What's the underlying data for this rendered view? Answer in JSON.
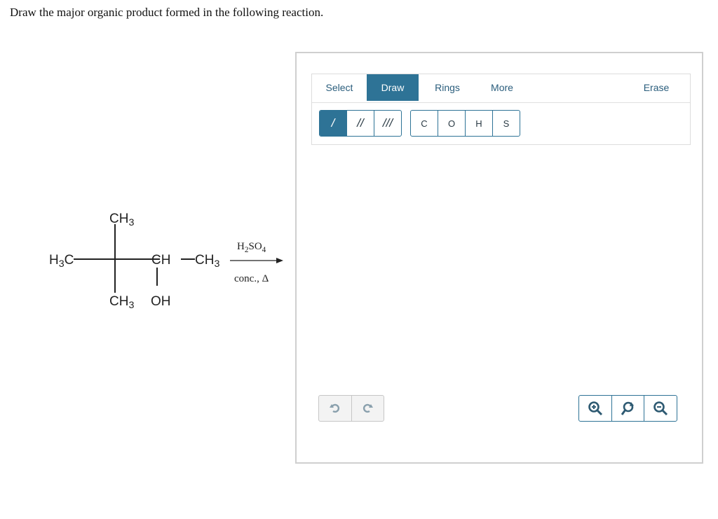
{
  "question": {
    "text": "Draw the major organic product formed in the following reaction."
  },
  "reaction": {
    "top_group": "CH3",
    "left_group": "H3C",
    "center_chain": "CH",
    "right_group": "CH3",
    "bottom_left": "CH3",
    "bottom_right": "OH",
    "reagent": "H2SO4",
    "conditions": "conc., Δ"
  },
  "editor": {
    "tabs": [
      {
        "label": "Select",
        "active": false
      },
      {
        "label": "Draw",
        "active": true
      },
      {
        "label": "Rings",
        "active": false
      },
      {
        "label": "More",
        "active": false
      },
      {
        "label": "Erase",
        "active": false
      }
    ],
    "bonds": [
      {
        "label": "/",
        "name": "single-bond",
        "active": true
      },
      {
        "label": "//",
        "name": "double-bond",
        "active": false
      },
      {
        "label": "///",
        "name": "triple-bond",
        "active": false
      }
    ],
    "atoms": [
      "C",
      "O",
      "H",
      "S"
    ],
    "icons": {
      "undo": "undo-icon",
      "redo": "redo-icon",
      "zoom_in": "zoom-in-icon",
      "zoom_reset": "zoom-reset-icon",
      "zoom_out": "zoom-out-icon"
    }
  },
  "colors": {
    "accent": "#2e7396",
    "tab_text": "#2a5d7c",
    "border": "#cfcfcf"
  }
}
